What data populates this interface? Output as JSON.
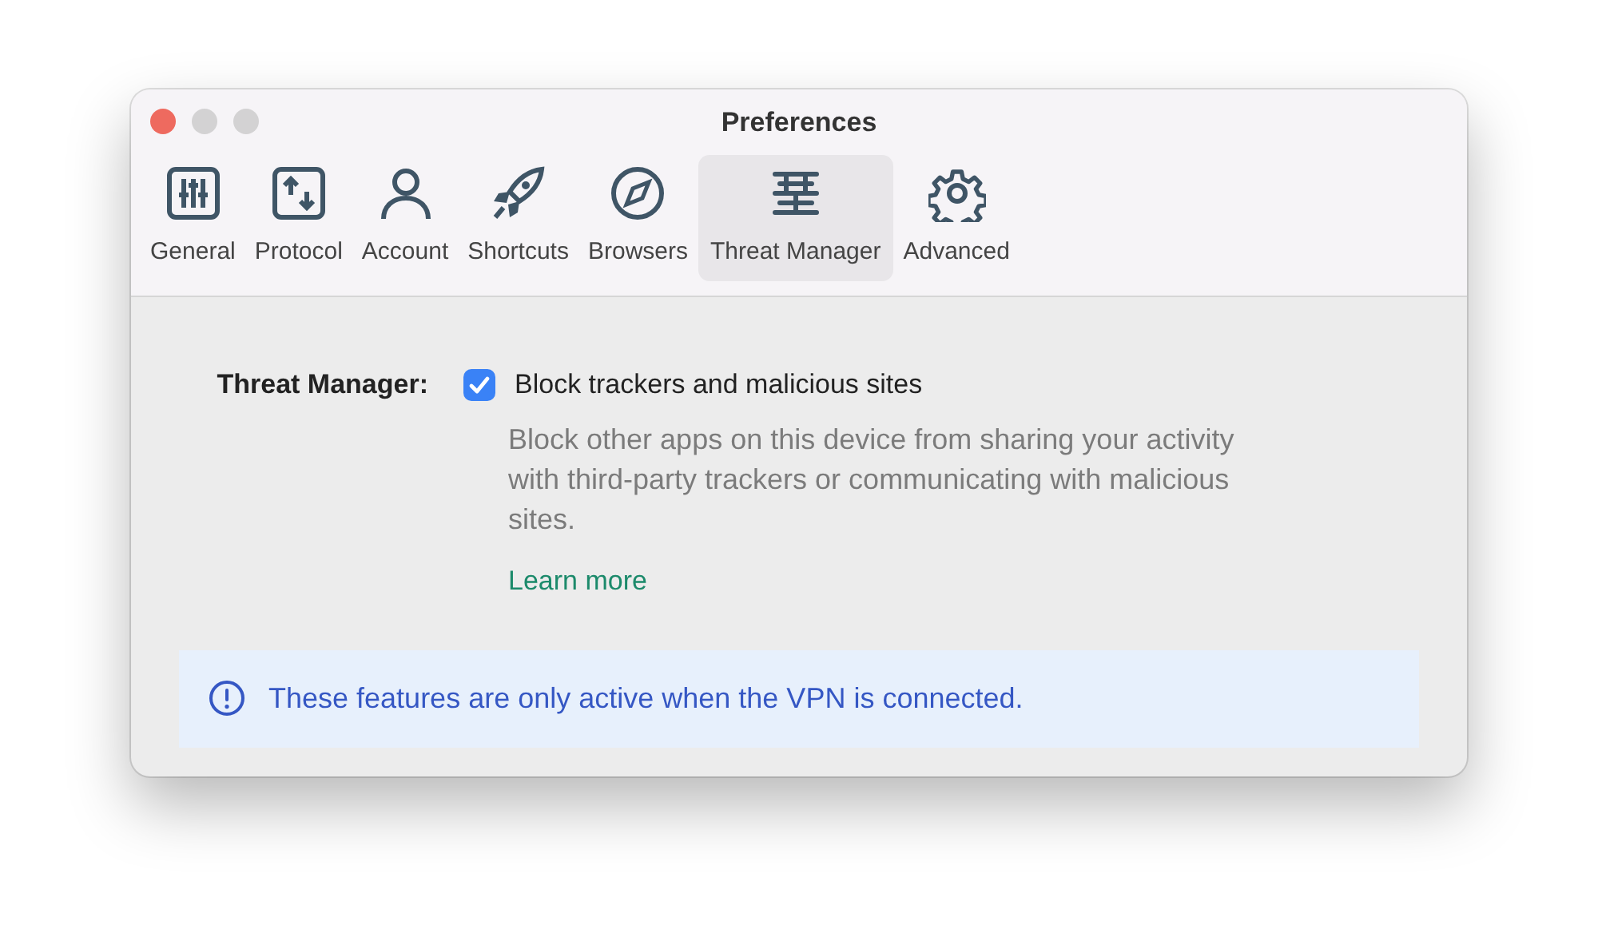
{
  "window": {
    "title": "Preferences"
  },
  "tabs": [
    {
      "label": "General",
      "selected": false
    },
    {
      "label": "Protocol",
      "selected": false
    },
    {
      "label": "Account",
      "selected": false
    },
    {
      "label": "Shortcuts",
      "selected": false
    },
    {
      "label": "Browsers",
      "selected": false
    },
    {
      "label": "Threat Manager",
      "selected": true
    },
    {
      "label": "Advanced",
      "selected": false
    }
  ],
  "setting": {
    "label": "Threat Manager:",
    "checkbox_label": "Block trackers and malicious sites",
    "checked": true,
    "description": "Block other apps on this device from sharing your activity with third-party trackers or communicating with malicious sites.",
    "link": "Learn more"
  },
  "notice": {
    "text": "These features are only active when the VPN is connected."
  }
}
